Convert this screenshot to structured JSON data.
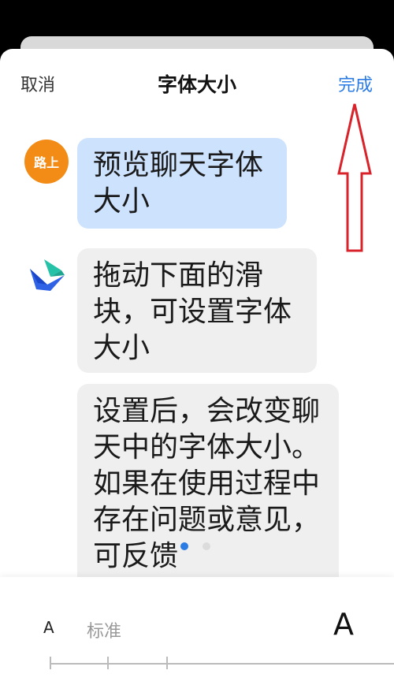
{
  "header": {
    "cancel_label": "取消",
    "title": "字体大小",
    "done_label": "完成"
  },
  "chat": {
    "my_avatar_text": "路上",
    "messages": [
      {
        "from": "me",
        "text": "预览聊天字体大小"
      },
      {
        "from": "bot",
        "text": "拖动下面的滑块，可设置字体大小"
      },
      {
        "from": "bot",
        "text": "设置后，会改变聊天中的字体大小。如果在使用过程中存在问题或意见，可反馈"
      }
    ]
  },
  "font_slider": {
    "small_label": "A",
    "standard_label": "标准",
    "large_label": "A"
  },
  "colors": {
    "accent": "#2a7be4",
    "my_bubble": "#cde2fd",
    "bot_bubble": "#efefef",
    "avatar": "#f28c16",
    "annotation_arrow": "#d9232b"
  },
  "icons": {
    "bot_avatar": "bird-logo-icon",
    "annotation": "red-up-arrow"
  }
}
